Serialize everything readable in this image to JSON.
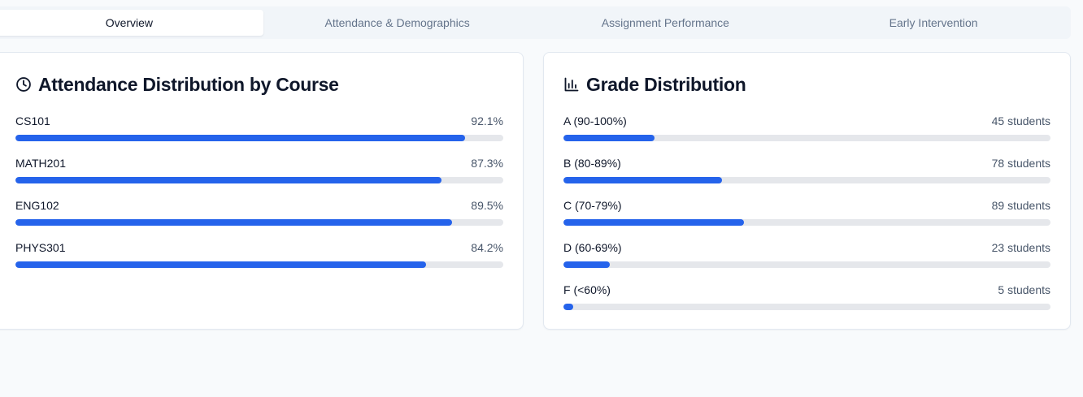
{
  "tabs": [
    {
      "label": "Overview",
      "active": true
    },
    {
      "label": "Attendance & Demographics",
      "active": false
    },
    {
      "label": "Assignment Performance",
      "active": false
    },
    {
      "label": "Early Intervention",
      "active": false
    }
  ],
  "attendance": {
    "title": "Attendance Distribution by Course",
    "icon": "clock-icon",
    "rows": [
      {
        "label": "CS101",
        "value": "92.1%",
        "fill_fraction": 0.921
      },
      {
        "label": "MATH201",
        "value": "87.3%",
        "fill_fraction": 0.873
      },
      {
        "label": "ENG102",
        "value": "89.5%",
        "fill_fraction": 0.895
      },
      {
        "label": "PHYS301",
        "value": "84.2%",
        "fill_fraction": 0.842
      }
    ]
  },
  "grades": {
    "title": "Grade Distribution",
    "icon": "bar-chart-icon",
    "rows": [
      {
        "label": "A (90-100%)",
        "value": "45 students",
        "fill_fraction": 0.1875
      },
      {
        "label": "B (80-89%)",
        "value": "78 students",
        "fill_fraction": 0.325
      },
      {
        "label": "C (70-79%)",
        "value": "89 students",
        "fill_fraction": 0.3708
      },
      {
        "label": "D (60-69%)",
        "value": "23 students",
        "fill_fraction": 0.0958
      },
      {
        "label": "F (<60%)",
        "value": "5 students",
        "fill_fraction": 0.0208
      }
    ]
  },
  "colors": {
    "accent": "#2563eb",
    "track": "#e5e7eb"
  }
}
